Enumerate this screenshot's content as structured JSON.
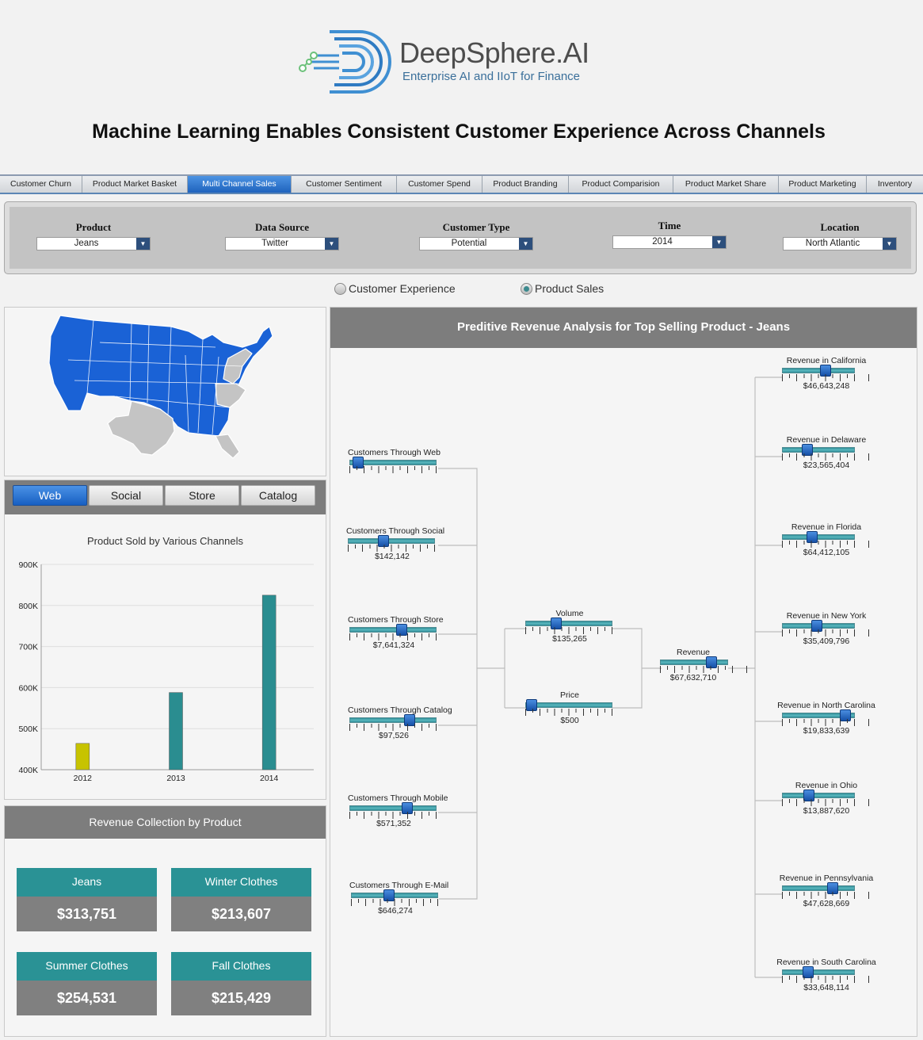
{
  "logo": {
    "name": "DeepSphere.AI",
    "tagline": "Enterprise AI and IIoT for Finance"
  },
  "page_title": "Machine Learning Enables Consistent Customer Experience Across Channels",
  "tabs": [
    {
      "label": "Customer Churn",
      "active": false
    },
    {
      "label": "Product Market Basket",
      "active": false
    },
    {
      "label": "Multi Channel Sales",
      "active": true
    },
    {
      "label": "Customer Sentiment",
      "active": false
    },
    {
      "label": "Customer Spend",
      "active": false
    },
    {
      "label": "Product Branding",
      "active": false
    },
    {
      "label": "Product Comparision",
      "active": false
    },
    {
      "label": "Product Market Share",
      "active": false
    },
    {
      "label": "Product Marketing",
      "active": false
    },
    {
      "label": "Inventory",
      "active": false
    }
  ],
  "filters": [
    {
      "label": "Product",
      "value": "Jeans"
    },
    {
      "label": "Data Source",
      "value": "Twitter"
    },
    {
      "label": "Customer Type",
      "value": "Potential"
    },
    {
      "label": "Time",
      "value": "2014"
    },
    {
      "label": "Location",
      "value": "North Atlantic"
    }
  ],
  "view_options": [
    {
      "label": "Customer Experience",
      "selected": false
    },
    {
      "label": "Product Sales",
      "selected": true
    }
  ],
  "map": {
    "colors": {
      "selected": "#1a62d6",
      "gray_dark": "#8a8a8a",
      "gray_light": "#c4c4c4"
    }
  },
  "channel_tabs": [
    {
      "label": "Web",
      "active": true
    },
    {
      "label": "Social",
      "active": false
    },
    {
      "label": "Store",
      "active": false
    },
    {
      "label": "Catalog",
      "active": false
    }
  ],
  "chart_data": {
    "type": "bar",
    "title": "Product Sold by Various Channels",
    "categories": [
      "2012",
      "2013",
      "2014"
    ],
    "values": [
      464000,
      588000,
      825000
    ],
    "colors": [
      "#c7c300",
      "#2a8d90",
      "#2a8d90"
    ],
    "ylim": [
      400000,
      900000
    ],
    "yticks": [
      "400K",
      "500K",
      "600K",
      "700K",
      "800K",
      "900K"
    ],
    "xlabel": "",
    "ylabel": "",
    "grid": true
  },
  "revenue_panel": {
    "title": "Revenue Collection by Product",
    "cards": [
      {
        "name": "Jeans",
        "value": "$313,751"
      },
      {
        "name": "Winter Clothes",
        "value": "$213,607"
      },
      {
        "name": "Summer Clothes",
        "value": "$254,531"
      },
      {
        "name": "Fall Clothes",
        "value": "$215,429"
      }
    ]
  },
  "predictive": {
    "title": "Preditive Revenue Analysis for Top Selling Product - Jeans",
    "inputs": [
      {
        "label": "Customers Through Web",
        "value": "",
        "level": 0.03
      },
      {
        "label": "Customers Through Social",
        "value": "$142,142",
        "level": 0.39
      },
      {
        "label": "Customers Through Store",
        "value": "$7,641,324",
        "level": 0.62
      },
      {
        "label": "Customers Through Catalog",
        "value": "$97,526",
        "level": 0.72
      },
      {
        "label": "Customers Through Mobile",
        "value": "$571,352",
        "level": 0.69
      },
      {
        "label": "Customers Through E-Mail",
        "value": "$646,274",
        "level": 0.43
      }
    ],
    "mid": [
      {
        "label": "Volume",
        "value": "$135,265",
        "level": 0.33
      },
      {
        "label": "Price",
        "value": "$500",
        "level": 0.0
      }
    ],
    "revenue": {
      "label": "Revenue",
      "value": "$67,632,710",
      "level": 0.82
    },
    "states": [
      {
        "label": "Revenue in California",
        "value": "$46,643,248",
        "level": 0.62
      },
      {
        "label": "Revenue in Delaware",
        "value": "$23,565,404",
        "level": 0.31
      },
      {
        "label": "Revenue in Florida",
        "value": "$64,412,105",
        "level": 0.39
      },
      {
        "label": "Revenue in New York",
        "value": "$35,409,796",
        "level": 0.48
      },
      {
        "label": "Revenue in North Carolina",
        "value": "$19,833,639",
        "level": 0.95
      },
      {
        "label": "Revenue in Ohio",
        "value": "$13,887,620",
        "level": 0.34
      },
      {
        "label": "Revenue in Pennsylvania",
        "value": "$47,628,669",
        "level": 0.74
      },
      {
        "label": "Revenue in South Carolina",
        "value": "$33,648,114",
        "level": 0.33
      }
    ]
  }
}
